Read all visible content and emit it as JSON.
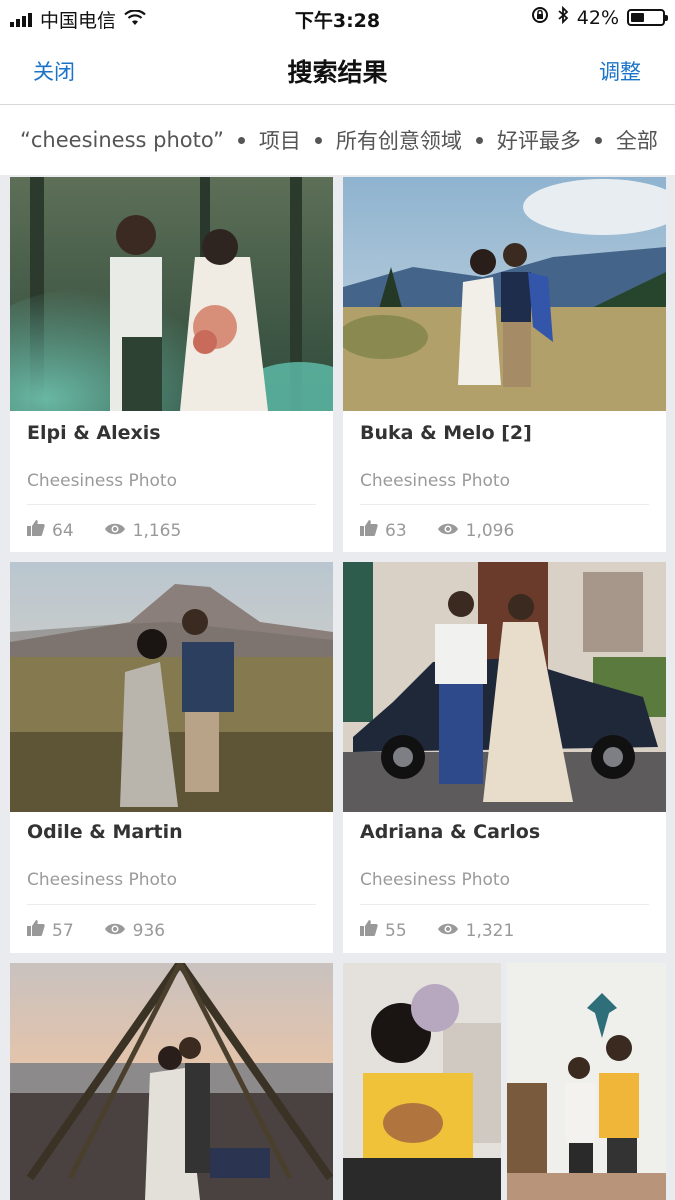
{
  "status": {
    "carrier": "中国电信",
    "time": "下午3:28",
    "battery": "42%",
    "battery_level": 0.42
  },
  "nav": {
    "close": "关闭",
    "title": "搜索结果",
    "adjust": "调整"
  },
  "filters": {
    "items": [
      "“cheesiness photo”",
      "项目",
      "所有创意领域",
      "好评最多",
      "全部"
    ]
  },
  "projects": [
    {
      "name": "Elpi & Alexis",
      "author": "Cheesiness Photo",
      "likes": "64",
      "views": "1,165"
    },
    {
      "name": "Buka & Melo [2]",
      "author": "Cheesiness Photo",
      "likes": "63",
      "views": "1,096"
    },
    {
      "name": "Odile & Martin",
      "author": "Cheesiness Photo",
      "likes": "57",
      "views": "936"
    },
    {
      "name": "Adriana & Carlos",
      "author": "Cheesiness Photo",
      "likes": "55",
      "views": "1,321"
    }
  ],
  "icons": {
    "like": "thumbs-up-icon",
    "views": "eye-icon",
    "wifi": "wifi-icon",
    "bluetooth": "bluetooth-icon",
    "lock_rotation": "rotation-lock-icon"
  },
  "colors": {
    "accent": "#1a73c8",
    "background": "#e9ebee"
  }
}
